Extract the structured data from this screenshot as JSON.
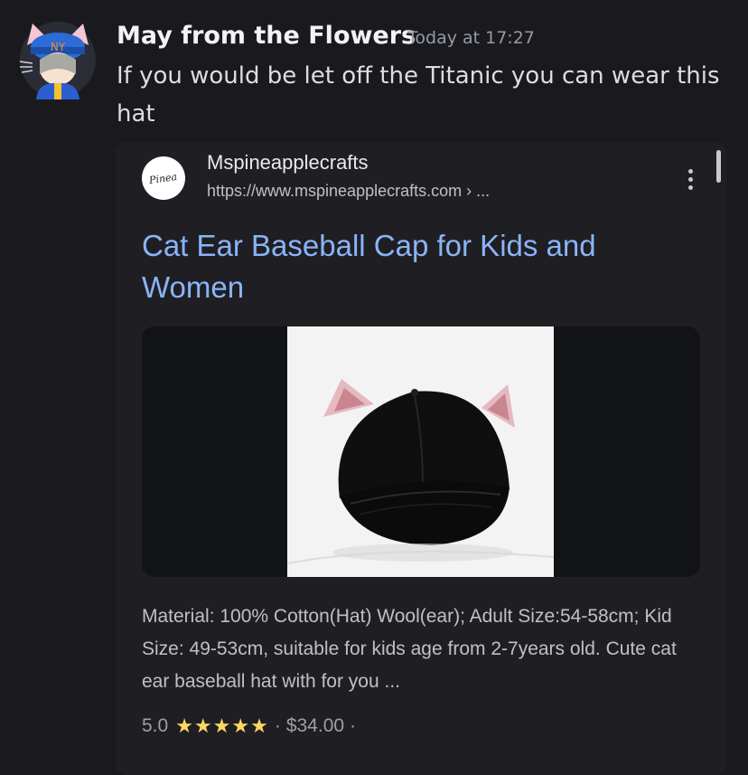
{
  "message": {
    "author": "May from the Flowers",
    "timestamp": "Today at 17:27",
    "text": "If you would be let off the Titanic you can wear this hat"
  },
  "embed": {
    "site_name": "Mspineapplecrafts",
    "site_url": "https://www.mspineapplecrafts.com › ...",
    "logo_text": "Pinea",
    "title": "Cat Ear Baseball Cap for Kids and Women",
    "snippet": "Material: 100% Cotton(Hat) Wool(ear); Adult Size:54-58cm; Kid Size: 49-53cm, suitable for kids age from 2-7years old. Cute cat ear baseball hat with for you ...",
    "rating": "5.0",
    "stars": "★★★★★",
    "separator": "·",
    "price": "$34.00",
    "trailing_separator": "·"
  },
  "colors": {
    "background": "#1a1a1e",
    "link_blue": "#8ab4f8",
    "star_yellow": "#fdd663"
  },
  "icons": [
    "avatar-image",
    "site-logo-icon",
    "more-options-icon",
    "product-image"
  ]
}
